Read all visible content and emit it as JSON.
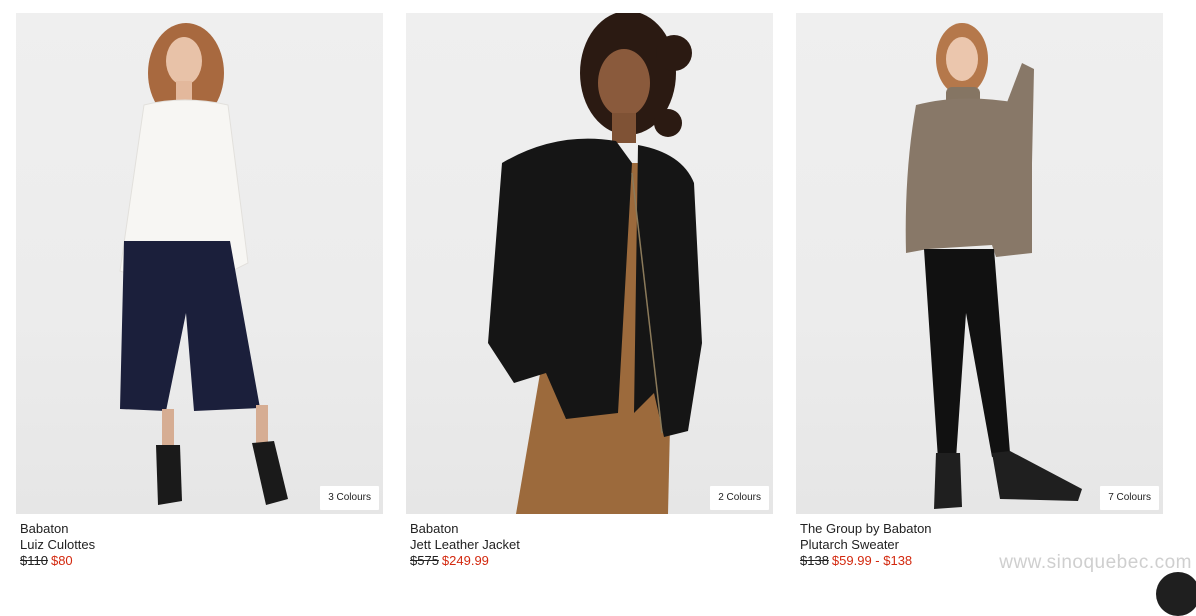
{
  "products": [
    {
      "brand": "Babaton",
      "name": "Luiz Culottes",
      "price_old": "$110",
      "price_sale": "$80",
      "colours": "3 Colours"
    },
    {
      "brand": "Babaton",
      "name": "Jett Leather Jacket",
      "price_old": "$575",
      "price_sale": "$249.99",
      "colours": "2 Colours"
    },
    {
      "brand": "The Group by Babaton",
      "name": "Plutarch Sweater",
      "price_old": "$138",
      "price_sale": "$59.99 - $138",
      "colours": "7 Colours"
    }
  ],
  "watermark": "www.sinoquebec.com",
  "colors": {
    "sale_price": "#d3290f",
    "image_bg": "#ececec"
  }
}
